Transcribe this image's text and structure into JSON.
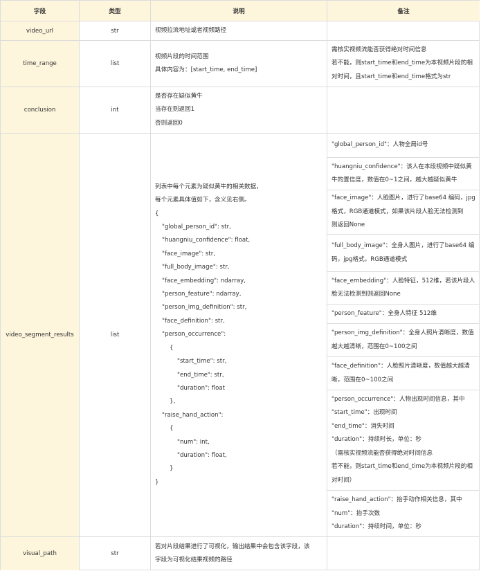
{
  "table": {
    "headers": {
      "field": "字段",
      "type": "类型",
      "desc": "说明",
      "note": "备注"
    },
    "rows": {
      "video_url": {
        "field": "video_url",
        "type": "str",
        "desc": [
          "视频拉流地址或者视频路径"
        ]
      },
      "time_range": {
        "field": "time_range",
        "type": "list",
        "desc": [
          "视频片段的时间范围",
          "具体内容为：[start_time, end_time]"
        ],
        "note": [
          "需核实视频流能否获得绝对时间信息",
          "若不能，则start_time和end_time为本视频片段的相",
          "对时间，且start_time和end_time格式为str"
        ]
      },
      "conclusion": {
        "field": "conclusion",
        "type": "int",
        "desc": [
          "是否存在疑似黄牛",
          "当存在则返回1",
          "否则返回0"
        ]
      },
      "video_segment_results": {
        "field": "video_segment_results",
        "type": "list",
        "desc": {
          "intro": [
            "列表中每个元素为疑似黄牛的相关数据，",
            "每个元素具体值如下，含义见右侧。"
          ],
          "open_brace": "{",
          "code": [
            "\"global_person_id\": str,",
            "\"huangniu_confidence\": float,",
            "\"face_image\": str,",
            "\"full_body_image\": str,",
            "\"face_embedding\": ndarray,",
            "\"person_feature\": ndarray,",
            "\"person_img_definition\": str,",
            "\"face_definition\": str,",
            "\"person_occurrence\":"
          ],
          "occ_open": "{",
          "occ_code": [
            "\"start_time\": str,",
            "\"end_time\": str,",
            "\"duration\": float"
          ],
          "occ_close": "},",
          "raise_key": "\"raise_hand_action\":",
          "raise_open": "{",
          "raise_code": [
            "\"num\": int,",
            "\"duration\": float,"
          ],
          "raise_close": "}",
          "close_brace": "}"
        },
        "notes": {
          "global_person_id": [
            "\"global_person_id\"：人物全局id号"
          ],
          "huangniu_confidence": [
            "\"huangniu_confidence\"：该人在本段视频中疑似黄",
            "牛的置信度，数值在0~1之间，越大越疑似黄牛"
          ],
          "face_image": [
            "\"face_image\"：人脸图片，进行了base64 编码，jpg",
            "格式，RGB通道模式，如果该片段人脸无法检测到",
            "则返回None"
          ],
          "full_body_image": [
            "\"full_body_image\"：全身人图片，进行了base64 编",
            "码，jpg格式，RGB通道模式"
          ],
          "face_embedding": [
            "\"face_embedding\"：人脸特征，512维，若该片段人",
            "脸无法检测到则返回None"
          ],
          "person_feature": [
            "\"person_feature\"：全身人特征 512维"
          ],
          "person_img_definition": [
            "\"person_img_definition\"：全身人照片清晰度，数值",
            "越大越清晰，范围在0~100之间"
          ],
          "face_definition": [
            "\"face_definition\"：人脸照片清晰度，数值越大越清",
            "晰，范围在0~100之间"
          ],
          "person_occurrence": [
            "\"person_occurrence\"：人物出现时间信息，其中",
            "\"start_time\"：出现时间",
            "\"end_time\"：消失时间",
            "\"duration\"：持续时长，单位：秒",
            "（需核实视频流能否获得绝对时间信息",
            "若不能，则start_time和end_time为本视频片段的相",
            "对时间）"
          ],
          "raise_hand_action": [
            "\"raise_hand_action\"：抬手动作相关信息，其中",
            "\"num\"：抬手次数",
            "\"duration\"：持续时间，单位：秒"
          ]
        }
      },
      "visual_path": {
        "field": "visual_path",
        "type": "str",
        "desc": [
          "若对片段结果进行了可视化，输出结果中会包含该字段，该",
          "字段为可视化结果视频的路径"
        ]
      }
    }
  }
}
